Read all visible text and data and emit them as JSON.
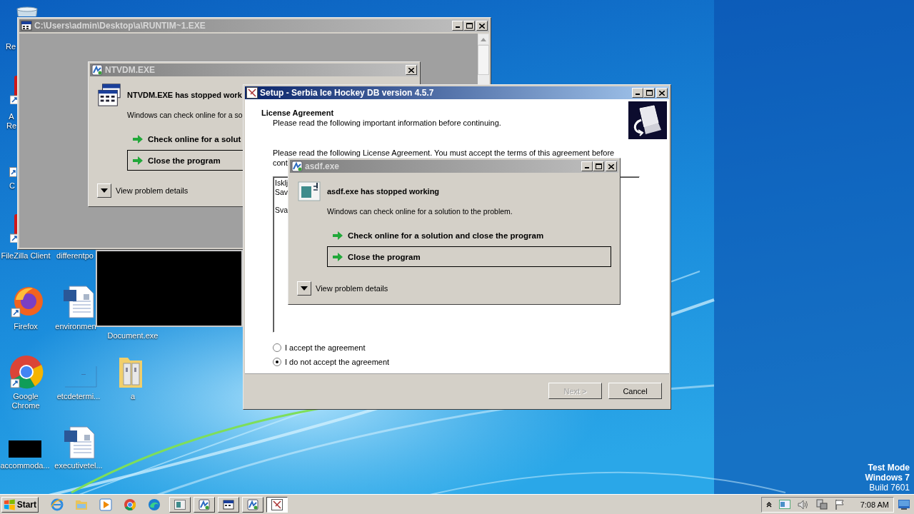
{
  "desktop": {
    "icons": [
      {
        "kind": "trash",
        "label": [
          "Re"
        ]
      },
      {
        "kind": "red-app",
        "label": [
          "A",
          "Re"
        ]
      },
      {
        "kind": "shortcut",
        "label": [
          "C"
        ]
      },
      {
        "kind": "red-app",
        "label": [
          "FileZilla Client"
        ]
      },
      {
        "label": [
          "differentpo"
        ]
      },
      {
        "kind": "fox",
        "label": [
          "Firefox"
        ]
      },
      {
        "kind": "document",
        "label": [
          "environmen"
        ]
      },
      {
        "label": [
          "Document.exe"
        ]
      },
      {
        "kind": "wheel",
        "label": [
          "Google",
          "Chrome"
        ]
      },
      {
        "kind": "blank",
        "label": [
          "etcdetermi..."
        ]
      },
      {
        "kind": "folder",
        "label": [
          "a"
        ]
      },
      {
        "kind": "dark-tile",
        "label": [
          "accommoda..."
        ]
      },
      {
        "kind": "document",
        "label": [
          "executivetel..."
        ]
      }
    ]
  },
  "console_window": {
    "title": "C:\\Users\\admin\\Desktop\\a\\RUNTIM~1.EXE",
    "active": false,
    "min_max_buttons": true
  },
  "ntvdm_dialog": {
    "title": "NTVDM.EXE",
    "active": false,
    "min_max_buttons": false,
    "heading": "NTVDM.EXE has stopped work",
    "message": "Windows can check online for a so",
    "options": [
      {
        "label": "Check online for a solut",
        "focused": false
      },
      {
        "label": "Close the program",
        "focused": true
      }
    ],
    "details_label": "View problem details"
  },
  "setup_window": {
    "title": "Setup - Serbia Ice Hockey DB version 4.5.7",
    "active": true,
    "min_max_buttons": true,
    "heading": "License Agreement",
    "subheading": "Please read the following important information before continuing.",
    "intro_lines": [
      "Please read the following License Agreement. You must accept the terms of this agreement before",
      "cont"
    ],
    "license_paragraphs": [
      [
        "Isklj",
        "Sav"
      ],
      [
        "Sva"
      ]
    ],
    "radios": [
      {
        "label": "I accept the agreement",
        "selected": false
      },
      {
        "label": "I do not accept the agreement",
        "selected": true
      }
    ],
    "buttons": [
      {
        "label": "Next >",
        "disabled": true
      },
      {
        "label": "Cancel",
        "disabled": false
      }
    ]
  },
  "asdf_dialog": {
    "title": "asdf.exe",
    "active": false,
    "min_max_buttons": true,
    "heading": "asdf.exe has stopped working",
    "message": "Windows can check online for a solution to the problem.",
    "options": [
      {
        "label": "Check online for a solution and close the program",
        "focused": false
      },
      {
        "label": "Close the program",
        "focused": true
      }
    ],
    "details_label": "View problem details"
  },
  "taskbar": {
    "start_label": "Start",
    "quick_launch": [
      {
        "kind": "e-globe"
      },
      {
        "kind": "folder"
      },
      {
        "kind": "media"
      },
      {
        "kind": "wheel"
      },
      {
        "kind": "wave"
      }
    ],
    "tasks": [
      {
        "kind": "window",
        "selected": false
      },
      {
        "kind": "dialog",
        "selected": false
      },
      {
        "kind": "console",
        "selected": false
      },
      {
        "kind": "dialog",
        "selected": false
      },
      {
        "kind": "setup",
        "selected": true
      }
    ],
    "clock": "7:08 AM"
  },
  "system_text": [
    "Test Mode",
    "Windows 7",
    "Build 7601"
  ]
}
